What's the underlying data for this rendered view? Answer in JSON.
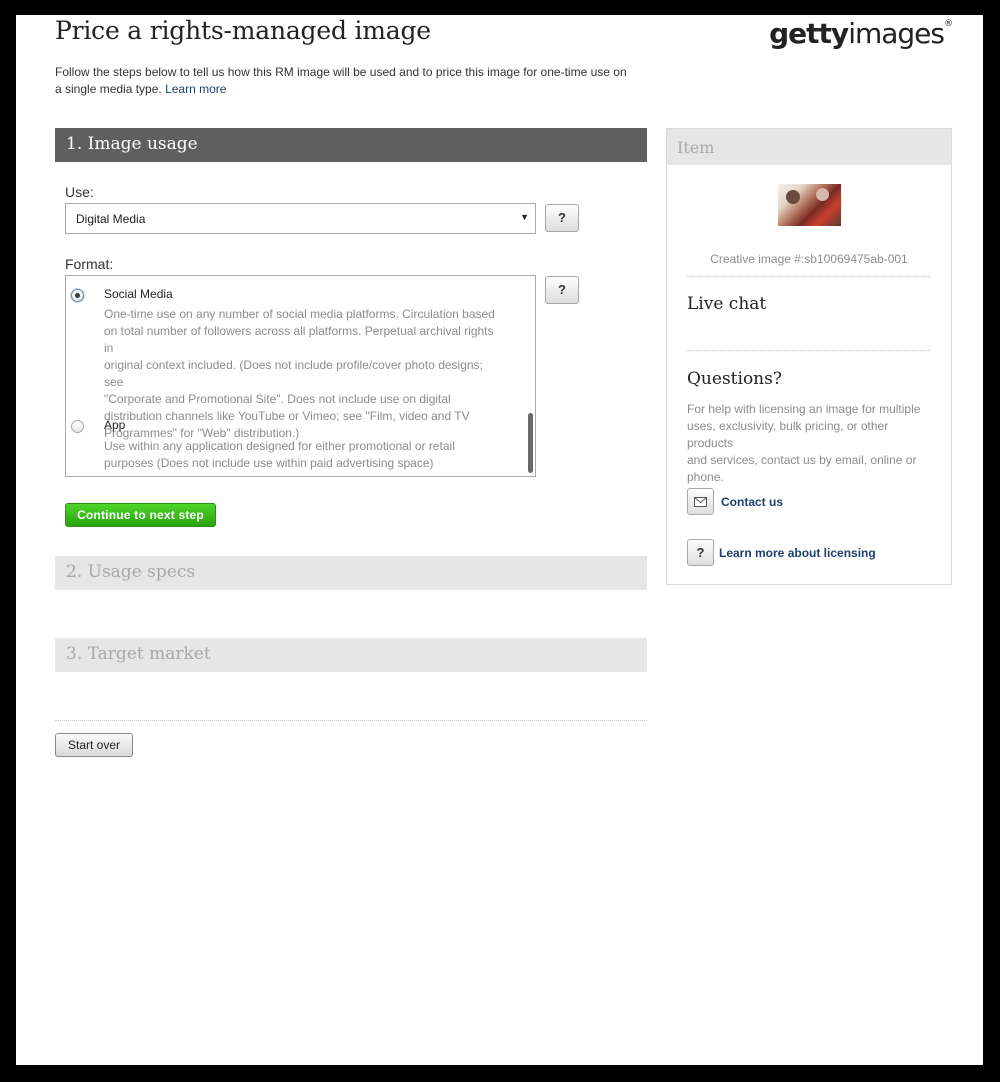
{
  "header": {
    "title": "Price a rights-managed image",
    "logo_bold": "getty",
    "logo_light": "images",
    "logo_mark": "®",
    "intro": "Follow the steps below to tell us how this RM image will be used and to price this image for one-time use on a single media type.",
    "learn_more": "Learn more"
  },
  "steps": {
    "step1": "1. Image usage",
    "step2": "2. Usage specs",
    "step3": "3. Target market"
  },
  "usage": {
    "use_label": "Use:",
    "use_value": "Digital Media",
    "format_label": "Format:",
    "help_symbol": "?",
    "options": [
      {
        "title": "Social Media",
        "selected": true,
        "lines": [
          "One-time use on any number of social media platforms. Circulation based",
          "on total number of followers across all platforms. Perpetual archival rights in",
          "original context included. (Does not include profile/cover photo designs; see",
          "\"Corporate and Promotional Site\". Does not include use on digital",
          "distribution channels like YouTube or Vimeo; see \"Film, video and TV",
          "Programmes\" for \"Web\" distribution.)"
        ]
      },
      {
        "title": "App",
        "selected": false,
        "lines": [
          "Use within any application designed for either promotional or retail",
          "purposes (Does not include use within paid advertising space)"
        ]
      }
    ],
    "continue": "Continue to next step",
    "start_over": "Start over"
  },
  "sidebar": {
    "item_title": "Item",
    "image_id": "Creative image #:sb10069475ab-001",
    "live_chat": "Live chat",
    "questions": "Questions?",
    "questions_desc": [
      "For help with licensing an image for multiple",
      "uses, exclusivity, bulk pricing, or other products",
      "and services, contact us by email, online or",
      "phone."
    ],
    "contact_us": "Contact us",
    "learn_licensing": "Learn more about licensing",
    "envelope_icon": "envelope-icon",
    "help_icon": "question-icon"
  },
  "colors": {
    "active_section": "#5f5f5f",
    "inactive_section": "#e6e6e6",
    "continue_button": "#33b316",
    "link": "#20406d"
  }
}
